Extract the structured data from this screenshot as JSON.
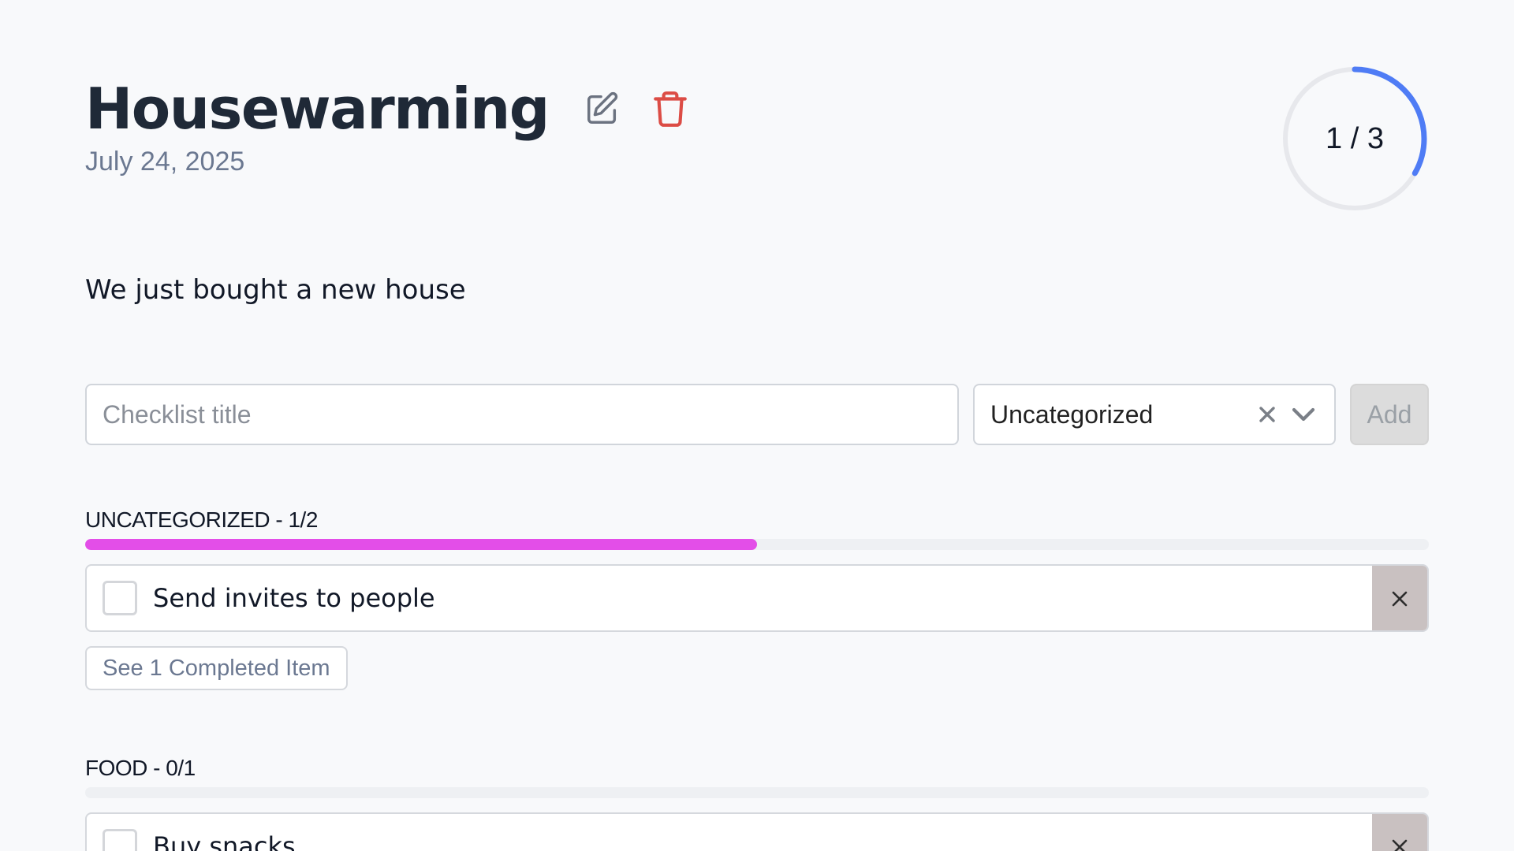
{
  "header": {
    "title": "Housewarming",
    "date": "July 24, 2025",
    "progress_label": "1 / 3",
    "progress_fraction": 0.333,
    "icons": {
      "edit": "edit-icon",
      "delete": "trash-icon"
    }
  },
  "description": "We just bought a new house",
  "add_form": {
    "title_placeholder": "Checklist title",
    "title_value": "",
    "category_value": "Uncategorized",
    "add_label": "Add"
  },
  "sections": [
    {
      "heading": "UNCATEGORIZED - 1/2",
      "progress_fraction": 0.5,
      "items": [
        {
          "label": "Send invites to people",
          "checked": false
        }
      ],
      "completed_button": "See 1 Completed Item"
    },
    {
      "heading": "FOOD - 0/1",
      "progress_fraction": 0,
      "items": [
        {
          "label": "Buy snacks",
          "checked": false
        }
      ]
    }
  ],
  "colors": {
    "accent_ring": "#4f7cf5",
    "section_bar": "#e34ee8",
    "delete_icon": "#dc4c45",
    "edit_icon": "#6b7280"
  }
}
